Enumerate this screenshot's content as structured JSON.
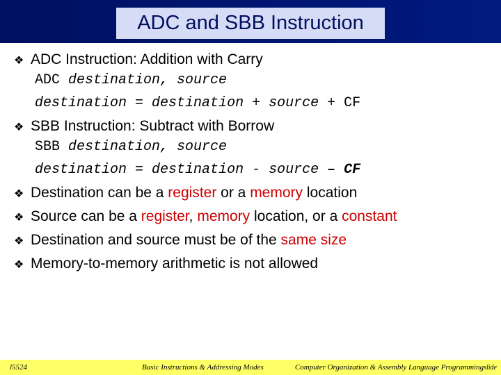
{
  "title": "ADC and SBB Instruction",
  "b1": "ADC Instruction: Addition with Carry",
  "c1a": "ADC ",
  "c1b": "destination, source",
  "c2a": "destination",
  "c2b": " = ",
  "c2c": "destination",
  "c2d": " + ",
  "c2e": "source",
  "c2f": " + CF",
  "b2": "SBB Instruction: Subtract with Borrow",
  "c3a": "SBB ",
  "c3b": "destination, source",
  "c4a": "destination",
  "c4b": " = ",
  "c4c": "destination",
  "c4d": " - ",
  "c4e": "source",
  "c4f": " – CF",
  "b3a": "Destination can be a ",
  "b3b": "register",
  "b3c": " or a ",
  "b3d": "memory",
  "b3e": " location",
  "b4a": "Source can be a ",
  "b4b": "register",
  "b4c": ", ",
  "b4d": "memory",
  "b4e": " location, or a ",
  "b4f": "constant",
  "b5a": "Destination and source must be of the ",
  "b5b": "same size",
  "b6": "Memory-to-memory arithmetic is not allowed",
  "footer_left": "l5524",
  "footer_mid": "Basic Instructions & Addressing Modes",
  "footer_right": "Computer Organization & Assembly Language Programming",
  "footer_slide": "slide"
}
